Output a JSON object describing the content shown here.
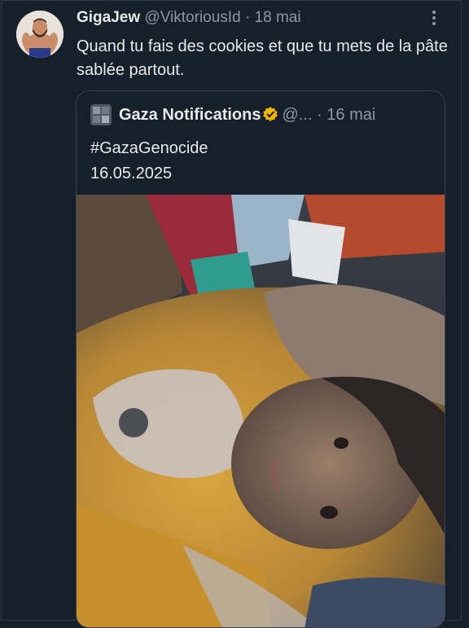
{
  "tweet": {
    "author_name": "GigaJew",
    "author_handle": "@ViktoriousId",
    "separator": "·",
    "date": "18 mai",
    "text": "Quand tu fais des cookies et que tu mets de la pâte sablée partout."
  },
  "quoted_tweet": {
    "author_name": "Gaza Notifications",
    "author_handle": "@...",
    "separator": "·",
    "date": "16 mai",
    "hashtag": "#GazaGenocide",
    "date_line": "16.05.2025"
  },
  "icons": {
    "more": "more-options-icon",
    "verified": "verified-badge-icon",
    "verified_color": "#f4b400"
  },
  "colors": {
    "background": "#15202b",
    "text": "#e7e9ea",
    "muted": "#8b98a5",
    "border": "#38444d"
  }
}
